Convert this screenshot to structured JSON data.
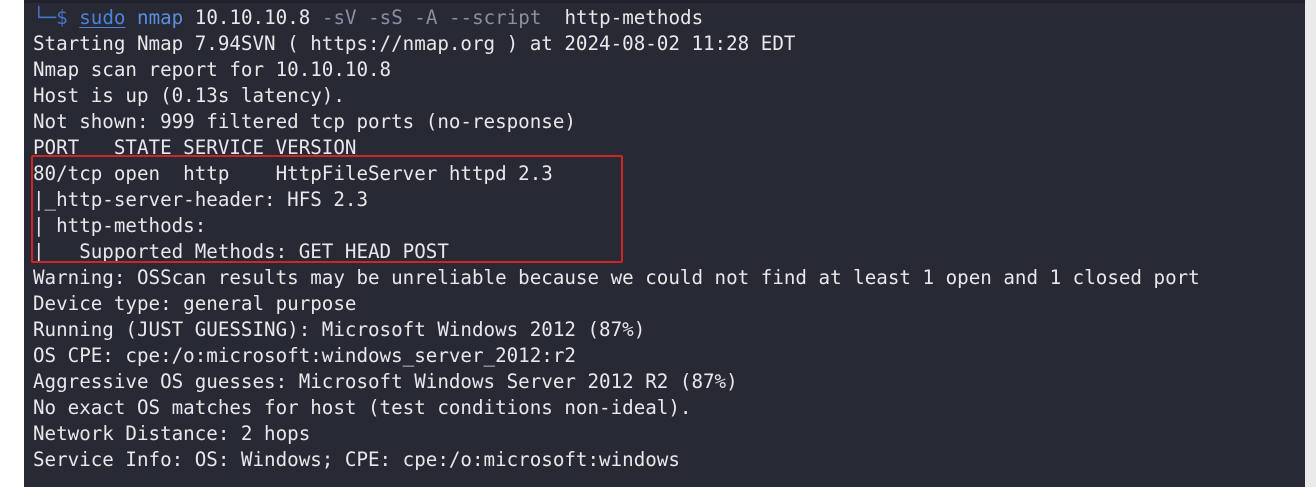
{
  "prompt": {
    "corner": "└─",
    "symbol": "$",
    "sudo": "sudo",
    "command": "nmap",
    "target": "10.10.10.8",
    "flags": "-sV -sS -A --script",
    "script_name": "http-methods"
  },
  "output": {
    "lines": [
      "Starting Nmap 7.94SVN ( https://nmap.org ) at 2024-08-02 11:28 EDT",
      "Nmap scan report for 10.10.10.8",
      "Host is up (0.13s latency).",
      "Not shown: 999 filtered tcp ports (no-response)",
      "PORT   STATE SERVICE VERSION",
      "80/tcp open  http    HttpFileServer httpd 2.3",
      "|_http-server-header: HFS 2.3",
      "| http-methods:",
      "|_  Supported Methods: GET HEAD POST",
      "Warning: OSScan results may be unreliable because we could not find at least 1 open and 1 closed port",
      "Device type: general purpose",
      "Running (JUST GUESSING): Microsoft Windows 2012 (87%)",
      "OS CPE: cpe:/o:microsoft:windows_server_2012:r2",
      "Aggressive OS guesses: Microsoft Windows Server 2012 R2 (87%)",
      "No exact OS matches for host (test conditions non-ideal).",
      "Network Distance: 2 hops",
      "Service Info: OS: Windows; CPE: cpe:/o:microsoft:windows"
    ]
  },
  "colors": {
    "terminal_bg": "#272935",
    "text": "#e8e8ea",
    "prompt": "#4a74c9",
    "highlight_border": "#d02525"
  }
}
